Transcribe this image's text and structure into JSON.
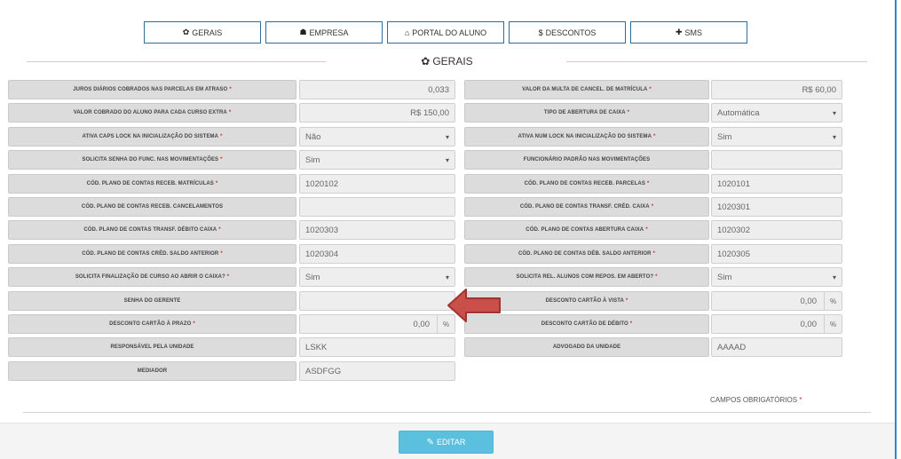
{
  "tabs": [
    {
      "label": "GERAIS",
      "icon": "gear-icon",
      "glyph": "✿"
    },
    {
      "label": "EMPRESA",
      "icon": "building-icon",
      "glyph": "☗"
    },
    {
      "label": "PORTAL DO ALUNO",
      "icon": "graduation-cap-icon",
      "glyph": "⌂"
    },
    {
      "label": "DESCONTOS",
      "icon": "dollar-icon",
      "glyph": "$"
    },
    {
      "label": "SMS",
      "icon": "plus-icon",
      "glyph": "✚"
    }
  ],
  "section": {
    "title": "GERAIS",
    "glyph": "✿"
  },
  "left": [
    {
      "label": "JUROS DIÁRIOS COBRADOS NAS PARCELAS EM ATRASO",
      "required": true,
      "value": "0,033"
    },
    {
      "label": "VALOR COBRADO DO ALUNO PARA CADA CURSO EXTRA",
      "required": true,
      "value": "R$ 150,00"
    },
    {
      "label": "ATIVA CAPS LOCK NA INICIALIZAÇÃO DO SISTEMA",
      "required": true,
      "value": "Não"
    },
    {
      "label": "SOLICITA SENHA DO FUNC. NAS MOVIMENTAÇÕES",
      "required": true,
      "value": "Sim"
    },
    {
      "label": "CÓD. PLANO DE CONTAS RECEB. MATRÍCULAS",
      "required": true,
      "value": "1020102"
    },
    {
      "label": "CÓD. PLANO DE CONTAS RECEB. CANCELAMENTOS",
      "required": false,
      "value": ""
    },
    {
      "label": "CÓD. PLANO DE CONTAS TRANSF. DÉBITO CAIXA",
      "required": true,
      "value": "1020303"
    },
    {
      "label": "CÓD. PLANO DE CONTAS CRÉD. SALDO ANTERIOR",
      "required": true,
      "value": "1020304"
    },
    {
      "label": "SOLICITA FINALIZAÇÃO DE CURSO AO ABRIR O CAIXA?",
      "required": true,
      "value": "Sim"
    },
    {
      "label": "SENHA DO GERENTE",
      "required": false,
      "value": ""
    },
    {
      "label": "DESCONTO CARTÃO À PRAZO",
      "required": true,
      "value": "0,00",
      "unit": "%"
    },
    {
      "label": "RESPONSÁVEL PELA UNIDADE",
      "required": false,
      "value": "LSKK"
    },
    {
      "label": "MEDIADOR",
      "required": false,
      "value": "ASDFGG"
    }
  ],
  "right": [
    {
      "label": "VALOR DA MULTA DE CANCEL. DE MATRÍCULA",
      "required": true,
      "value": "R$ 60,00"
    },
    {
      "label": "TIPO DE ABERTURA DE CAIXA",
      "required": true,
      "value": "Automática"
    },
    {
      "label": "ATIVA NUM LOCK NA INICIALIZAÇÃO DO SISTEMA",
      "required": true,
      "value": "Sim"
    },
    {
      "label": "FUNCIONÁRIO PADRÃO NAS MOVIMENTAÇÕES",
      "required": false,
      "value": ""
    },
    {
      "label": "CÓD. PLANO DE CONTAS RECEB. PARCELAS",
      "required": true,
      "value": "1020101"
    },
    {
      "label": "CÓD. PLANO DE CONTAS TRANSF. CRÉD. CAIXA",
      "required": true,
      "value": "1020301"
    },
    {
      "label": "CÓD. PLANO DE CONTAS ABERTURA CAIXA",
      "required": true,
      "value": "1020302"
    },
    {
      "label": "CÓD. PLANO DE CONTAS DÉB. SALDO ANTERIOR",
      "required": true,
      "value": "1020305"
    },
    {
      "label": "SOLICITA REL. ALUNOS COM REPOS. EM ABERTO?",
      "required": true,
      "value": "Sim"
    },
    {
      "label": "DESCONTO CARTÃO À VISTA",
      "required": true,
      "value": "0,00",
      "unit": "%"
    },
    {
      "label": "DESCONTO CARTÃO DE DÉBITO",
      "required": true,
      "value": "0,00",
      "unit": "%"
    },
    {
      "label": "ADVOGADO DA UNIDADE",
      "required": false,
      "value": "AAAAD"
    }
  ],
  "required_note": {
    "text": "CAMPOS OBRIGATÓRIOS",
    "star": "*"
  },
  "edit_button": {
    "label": "EDITAR",
    "glyph": "✎"
  },
  "colors": {
    "accent": "#5bc0de",
    "arrow": "#c9504a",
    "required": "#c0392b",
    "border": "#2f86c6"
  }
}
